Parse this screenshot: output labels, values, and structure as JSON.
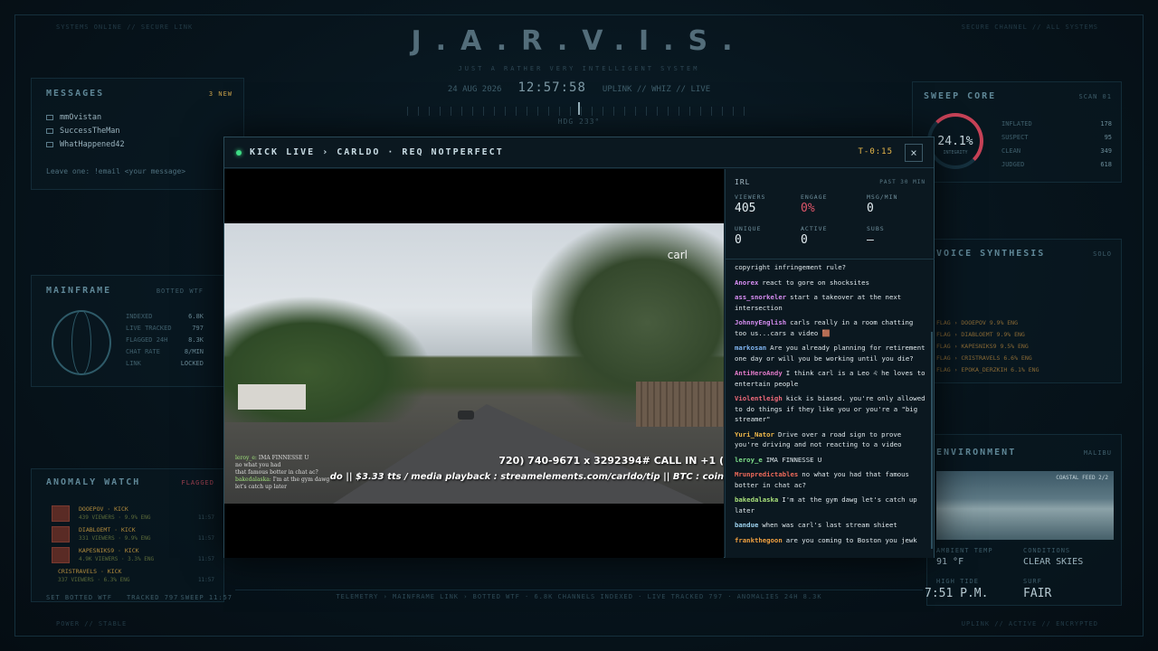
{
  "hud": {
    "title": "J.A.R.V.I.S.",
    "subtitle": "JUST A RATHER VERY INTELLIGENT SYSTEM",
    "date": "24 AUG 2026",
    "clock": "12:57:58",
    "link": "UPLINK // WHIZ // LIVE",
    "heading": "HDG 233°",
    "corner_tl": "SYSTEMS ONLINE // SECURE LINK",
    "corner_tr": "SECURE CHANNEL // ALL SYSTEMS",
    "corner_bl": "POWER // STABLE",
    "corner_br": "UPLINK // ACTIVE // ENCRYPTED"
  },
  "messages_panel": {
    "title": "MESSAGES",
    "badge": "3 NEW",
    "items": [
      "mmOvistan",
      "SuccessTheMan",
      "WhatHappened42"
    ],
    "hint": "Leave one: !email <your message>"
  },
  "mainframe": {
    "title": "MAINFRAME",
    "tag": "BOTTED WTF",
    "rows": [
      {
        "k": "INDEXED",
        "v": "6.8K"
      },
      {
        "k": "LIVE TRACKED",
        "v": "797"
      },
      {
        "k": "FLAGGED 24H",
        "v": "8.3K"
      },
      {
        "k": "CHAT RATE",
        "v": "8/MIN"
      },
      {
        "k": "LINK",
        "v": "LOCKED"
      }
    ]
  },
  "anomaly": {
    "title": "ANOMALY WATCH",
    "tag": "FLAGGED",
    "items": [
      {
        "name": "DOOEPOV · KICK",
        "stat": "439 VIEWERS · 9.9% ENG",
        "time": "11:57"
      },
      {
        "name": "DIABLOEMT · KICK",
        "stat": "331 VIEWERS · 9.9% ENG",
        "time": "11:57"
      },
      {
        "name": "KAPESNIKS9 · KICK",
        "stat": "4.9K VIEWERS · 3.3% ENG",
        "time": "11:57"
      },
      {
        "name": "CRISTRAVELS · KICK",
        "stat": "337 VIEWERS · 6.3% ENG",
        "time": "11:57"
      }
    ],
    "footer_left": "SET BOTTED WTF",
    "footer_mid": "TRACKED 797",
    "footer_right": "SWEEP 11:57"
  },
  "sweep": {
    "title": "SWEEP CORE",
    "tag": "SCAN 01",
    "percent": "24.1%",
    "percent_label": "INTEGRITY",
    "rows": [
      {
        "k": "INFLATED",
        "v": "178"
      },
      {
        "k": "SUSPECT",
        "v": "95"
      },
      {
        "k": "CLEAN",
        "v": "349"
      },
      {
        "k": "JUDGED",
        "v": "618"
      }
    ]
  },
  "voice": {
    "title": "VOICE SYNTHESIS",
    "tag": "SOLO",
    "rows": [
      "FLAG › DOOEPOV 9.9% ENG",
      "FLAG › DIABLOEMT 9.9% ENG",
      "FLAG › KAPESNIKS9 9.5% ENG",
      "FLAG › CRISTRAVELS 6.6% ENG",
      "FLAG › EPOKA_DERZKIH 6.1% ENG"
    ]
  },
  "environment": {
    "title": "ENVIRONMENT",
    "tag": "MALIBU",
    "cam_label": "COASTAL FEED 2/2",
    "ambient_label": "AMBIENT TEMP",
    "ambient_value": "91 °F",
    "conditions_label": "CONDITIONS",
    "conditions_value": "CLEAR SKIES",
    "high_label": "HIGH TIDE",
    "high_value": "7:51 P.M.",
    "surf_label": "SURF",
    "surf_value": "FAIR"
  },
  "telemetry": "TELEMETRY ›   MAINFRAME LINK › BOTTED WTF   ·   6.8K CHANNELS INDEXED   ·   LIVE TRACKED 797   ·   ANOMALIES 24H  8.3K",
  "modal": {
    "title": "KICK LIVE › CARLDO · REQ NOTPERFECT",
    "timer": "T-0:15",
    "close": "×",
    "video": {
      "label": "carl",
      "ticker1": "720) 740-9671 x 3292394#   CALL IN +1 (",
      "ticker2": "do || $3.33 tts / media playback : streamelements.com/carldo/tip || BTC : coin",
      "overlay": [
        {
          "n": "leroy_e:",
          "t": " IMA FINNESSE U"
        },
        {
          "n": "",
          "t": "no what you had"
        },
        {
          "n": "",
          "t": "that famous botter in chat ac?"
        },
        {
          "n": "bakedalaska:",
          "t": " I'm at the gym dawg"
        },
        {
          "n": "",
          "t": "let's catch up later"
        }
      ]
    },
    "stats": {
      "category": "IRL",
      "range": "PAST 30 MIN",
      "items": [
        {
          "label": "VIEWERS",
          "value": "405"
        },
        {
          "label": "ENGAGE",
          "value": "0%"
        },
        {
          "label": "MSG/MIN",
          "value": "0"
        },
        {
          "label": "UNIQUE",
          "value": "0"
        },
        {
          "label": "ACTIVE",
          "value": "0"
        },
        {
          "label": "SUBS",
          "value": "—"
        }
      ]
    },
    "chat": [
      {
        "user": "",
        "color": "#dfe8ec",
        "text": "copyright infringement rule?"
      },
      {
        "user": "Anorex",
        "color": "#d58cf0",
        "text": "react to gore on shocksites"
      },
      {
        "user": "ass_snorkeler",
        "color": "#d58cf0",
        "text": "start a takeover at the next intersection"
      },
      {
        "user": "JohnnyEnglish",
        "color": "#d58cf0",
        "text": "carls really in a room chatting too us...cars a video 🟫"
      },
      {
        "user": "markosan",
        "color": "#7fb4f0",
        "text": "Are you already planning for retirement one day or will you be working until you die?"
      },
      {
        "user": "AntiHeroAndy",
        "color": "#e07ac8",
        "text": "I think carl is a Leo ♌ he loves to entertain people"
      },
      {
        "user": "Violentleigh",
        "color": "#f06a7a",
        "text": "kick is biased. you're only allowed to do things if they like you or you're a \"big streamer\""
      },
      {
        "user": "Yuri_Nator",
        "color": "#f0b84a",
        "text": "Drive over a road sign to prove you're driving and not reacting to a video"
      },
      {
        "user": "leroy_e",
        "color": "#7ee08a",
        "text": "IMA FINNESSE U"
      },
      {
        "user": "Mrunpredictables",
        "color": "#f06a5a",
        "text": "no what you had that famous botter in chat ac?"
      },
      {
        "user": "bakedalaska",
        "color": "#a8e07a",
        "text": "I'm at the gym dawg let's catch up later"
      },
      {
        "user": "bandue",
        "color": "#9fd4f0",
        "text": "when was carl's last stream shieet"
      },
      {
        "user": "frankthegoon",
        "color": "#f0a040",
        "text": "are you coming to Boston you jewk"
      }
    ]
  }
}
